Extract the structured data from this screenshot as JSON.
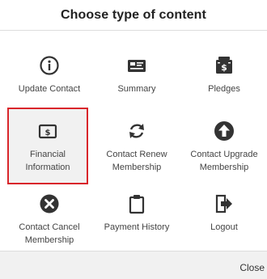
{
  "dialog": {
    "title": "Choose type of content",
    "close_label": "Close"
  },
  "options": [
    {
      "label": "Update Contact",
      "icon": "info-icon"
    },
    {
      "label": "Summary",
      "icon": "summary-card-icon"
    },
    {
      "label": "Pledges",
      "icon": "pledges-icon"
    },
    {
      "label": "Financial Information",
      "icon": "dollar-card-icon",
      "selected": true
    },
    {
      "label": "Contact Renew Membership",
      "icon": "renew-icon"
    },
    {
      "label": "Contact Upgrade Membership",
      "icon": "upgrade-arrow-icon"
    },
    {
      "label": "Contact Cancel Membership",
      "icon": "cancel-icon"
    },
    {
      "label": "Payment History",
      "icon": "clipboard-icon"
    },
    {
      "label": "Logout",
      "icon": "logout-icon"
    }
  ],
  "colors": {
    "selected_border": "#d9262b",
    "icon": "#333333",
    "footer_bg": "#f1f1f1"
  }
}
